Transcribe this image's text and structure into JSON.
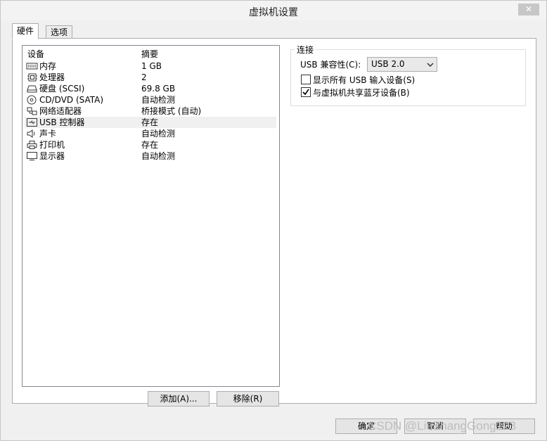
{
  "window": {
    "title": "虚拟机设置",
    "close_label": "✕"
  },
  "tabs": [
    {
      "label": "硬件"
    },
    {
      "label": "选项"
    }
  ],
  "device_list": {
    "headers": {
      "device": "设备",
      "summary": "摘要"
    },
    "rows": [
      {
        "name": "内存",
        "summary": "1 GB",
        "icon": "memory-icon"
      },
      {
        "name": "处理器",
        "summary": "2",
        "icon": "processor-icon"
      },
      {
        "name": "硬盘 (SCSI)",
        "summary": "69.8 GB",
        "icon": "hard-disk-icon"
      },
      {
        "name": "CD/DVD (SATA)",
        "summary": "自动检测",
        "icon": "cd-dvd-icon"
      },
      {
        "name": "网络适配器",
        "summary": "桥接模式 (自动)",
        "icon": "network-adapter-icon"
      },
      {
        "name": "USB 控制器",
        "summary": "存在",
        "icon": "usb-controller-icon"
      },
      {
        "name": "声卡",
        "summary": "自动检测",
        "icon": "sound-card-icon"
      },
      {
        "name": "打印机",
        "summary": "存在",
        "icon": "printer-icon"
      },
      {
        "name": "显示器",
        "summary": "自动检测",
        "icon": "display-icon"
      }
    ],
    "selected_index": 5
  },
  "list_buttons": {
    "add": "添加(A)...",
    "remove": "移除(R)"
  },
  "connection": {
    "legend": "连接",
    "compat_label": "USB 兼容性(C):",
    "compat_value": "USB 2.0",
    "show_all_usb": {
      "label": "显示所有 USB 输入设备(S)",
      "checked": false
    },
    "share_bluetooth": {
      "label": "与虚拟机共享蓝牙设备(B)",
      "checked": true
    }
  },
  "footer": {
    "ok": "确定",
    "cancel": "取消",
    "help": "帮助"
  },
  "watermark": "CSDN @LiuZhangGong123"
}
